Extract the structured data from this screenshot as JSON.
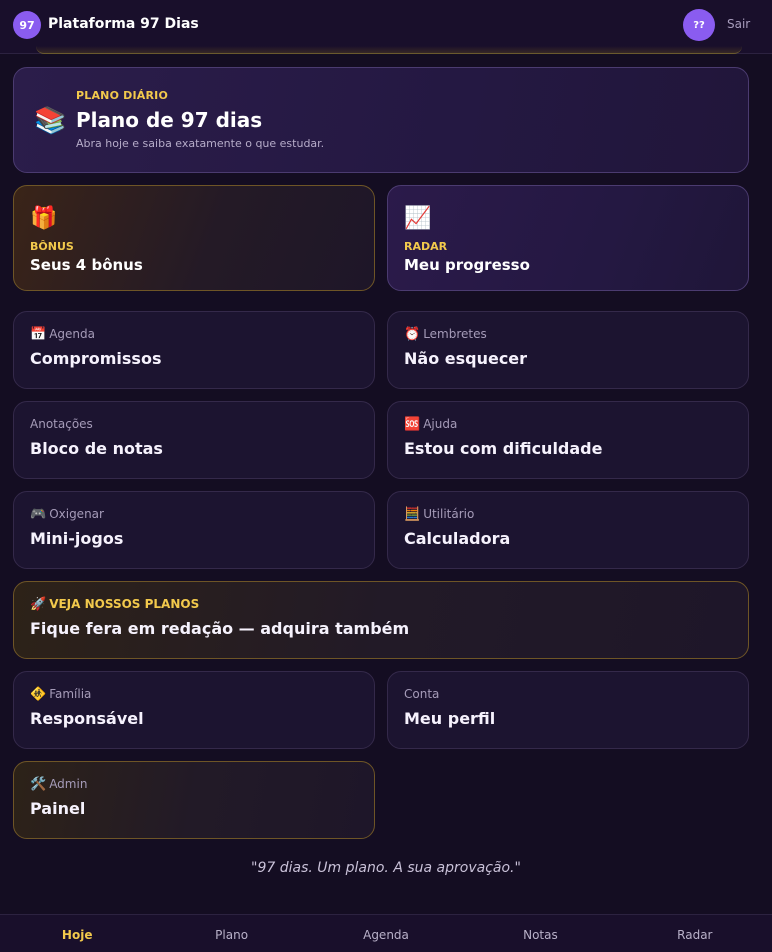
{
  "header": {
    "logo_badge": "97",
    "app_title": "Plataforma 97 Dias",
    "avatar_text": "??",
    "logout_label": "Sair"
  },
  "hero": {
    "icon": "books-icon",
    "kicker": "PLANO DIÁRIO",
    "title": "Plano de 97 dias",
    "subtitle": "Abra hoje e saiba exatamente o que estudar."
  },
  "features": [
    {
      "icon": "gift-icon",
      "kicker": "BÔNUS",
      "title": "Seus 4 bônus"
    },
    {
      "icon": "chart-up-icon",
      "kicker": "RADAR",
      "title": "Meu progresso"
    }
  ],
  "cards": [
    {
      "icon": "calendar-icon",
      "kicker": "Agenda",
      "title": "Compromissos"
    },
    {
      "icon": "alarm-clock-icon",
      "kicker": "Lembretes",
      "title": "Não esquecer"
    },
    {
      "icon": "",
      "kicker": "Anotações",
      "title": "Bloco de notas"
    },
    {
      "icon": "sos-icon",
      "kicker": "Ajuda",
      "title": "Estou com dificuldade"
    },
    {
      "icon": "gamepad-icon",
      "kicker": "Oxigenar",
      "title": "Mini-jogos"
    },
    {
      "icon": "abacus-icon",
      "kicker": "Utilitário",
      "title": "Calculadora"
    }
  ],
  "promo": {
    "icon": "rocket-icon",
    "kicker": "VEJA NOSSOS PLANOS",
    "title": "Fique fera em redação — adquira também"
  },
  "cards2": [
    {
      "icon": "family-icon",
      "kicker": "Família",
      "title": "Responsável"
    },
    {
      "icon": "",
      "kicker": "Conta",
      "title": "Meu perfil"
    }
  ],
  "admin": {
    "icon": "tools-icon",
    "kicker": "Admin",
    "title": "Painel"
  },
  "quote": "\"97 dias. Um plano. A sua aprovação.\"",
  "nav": {
    "items": [
      "Hoje",
      "Plano",
      "Agenda",
      "Notas",
      "Radar"
    ],
    "active": "Hoje"
  },
  "colors": {
    "accent_gold": "#f2c94c",
    "accent_purple": "#8a5cf0",
    "background": "#140d22"
  }
}
